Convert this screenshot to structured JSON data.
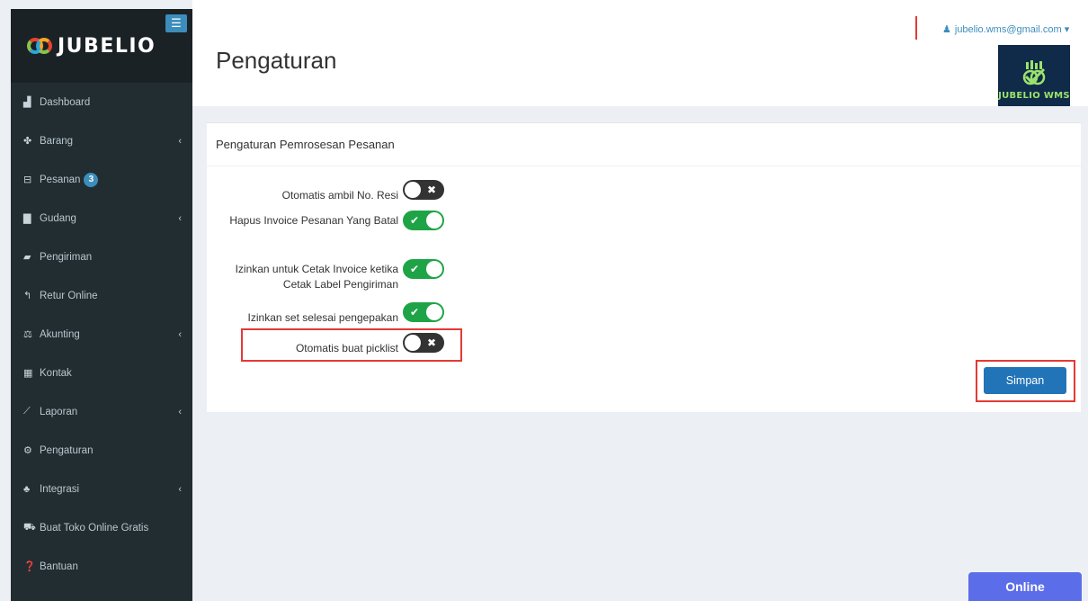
{
  "app": {
    "brand": "JUBELIO",
    "menu_toggle_icon": "bars-icon"
  },
  "sidebar": {
    "items": [
      {
        "label": "Dashboard",
        "icon": "area-chart-icon",
        "glyph": "▟",
        "chevron": false
      },
      {
        "label": "Barang",
        "icon": "cubes-icon",
        "glyph": "✤",
        "chevron": true
      },
      {
        "label": "Pesanan",
        "icon": "inbox-icon",
        "glyph": "⊟",
        "chevron": false,
        "badge": "3"
      },
      {
        "label": "Gudang",
        "icon": "building-icon",
        "glyph": "▇",
        "chevron": true
      },
      {
        "label": "Pengiriman",
        "icon": "truck-icon",
        "glyph": "▰",
        "chevron": false
      },
      {
        "label": "Retur Online",
        "icon": "reply-icon",
        "glyph": "↰",
        "chevron": false
      },
      {
        "label": "Akunting",
        "icon": "balance-scale-icon",
        "glyph": "⚖",
        "chevron": true
      },
      {
        "label": "Kontak",
        "icon": "address-card-icon",
        "glyph": "▦",
        "chevron": false
      },
      {
        "label": "Laporan",
        "icon": "line-chart-icon",
        "glyph": "⟋",
        "chevron": true
      },
      {
        "label": "Pengaturan",
        "icon": "cogs-icon",
        "glyph": "⚙",
        "chevron": false
      },
      {
        "label": "Integrasi",
        "icon": "sitemap-icon",
        "glyph": "♣",
        "chevron": true
      },
      {
        "label": "Buat Toko Online Gratis",
        "icon": "shopping-cart-icon",
        "glyph": "⛟",
        "chevron": false
      },
      {
        "label": "Bantuan",
        "icon": "question-circle-icon",
        "glyph": "❓",
        "chevron": false
      }
    ],
    "chevron_glyph": "‹"
  },
  "header": {
    "title": "Pengaturan",
    "user_email": "jubelio.wms@gmail.com",
    "user_icon": "user-icon",
    "dropdown_glyph": "▾",
    "brand_badge": "JUBELIO WMS"
  },
  "panel": {
    "title": "Pengaturan Pemrosesan Pesanan",
    "settings": [
      {
        "label": "Otomatis ambil No. Resi",
        "on": false
      },
      {
        "label": "Hapus Invoice Pesanan Yang Batal",
        "on": true
      },
      {
        "label": "Izinkan untuk Cetak Invoice ketika Cetak Label Pengiriman",
        "on": true
      },
      {
        "label": "Izinkan set selesai pengepakan",
        "on": true
      },
      {
        "label": "Otomatis buat picklist",
        "on": false
      }
    ],
    "toggle_on_mark": "✔",
    "toggle_off_mark": "✖",
    "save_label": "Simpan"
  },
  "footer": {
    "online_label": "Online"
  },
  "colors": {
    "sidebar_bg": "#222d32",
    "accent": "#3c8dbc",
    "toggle_on": "#1ea446",
    "toggle_off": "#333333",
    "save_button": "#2274b8",
    "online_button": "#5b6de9",
    "highlight": "#e53935"
  }
}
